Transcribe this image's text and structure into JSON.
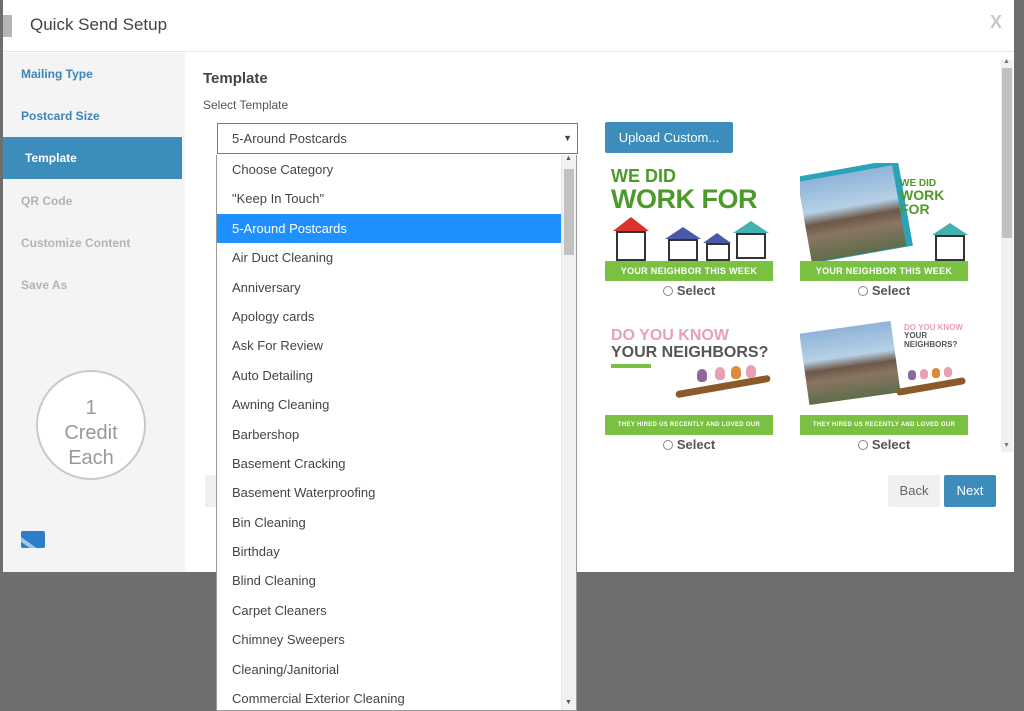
{
  "header": {
    "title": "Quick Send Setup",
    "close_label": "X"
  },
  "sidebar": {
    "items": [
      {
        "label": "Mailing Type",
        "state": "done"
      },
      {
        "label": "Postcard Size",
        "state": "done"
      },
      {
        "label": "Template",
        "state": "active"
      },
      {
        "label": "QR Code",
        "state": "todo"
      },
      {
        "label": "Customize Content",
        "state": "todo"
      },
      {
        "label": "Save As",
        "state": "todo"
      }
    ],
    "credit": {
      "number": "1",
      "line1": "Credit",
      "line2": "Each"
    }
  },
  "main": {
    "title": "Template",
    "subtitle": "Select Template",
    "select_value": "5-Around Postcards",
    "upload_label": "Upload Custom...",
    "templates": [
      {
        "line1": "WE DID",
        "line2": "WORK FOR",
        "band": "YOUR NEIGHBOR THIS WEEK",
        "select_label": "Select"
      },
      {
        "line1": "WE DID",
        "line2": "WORK FOR",
        "band": "YOUR NEIGHBOR THIS WEEK",
        "select_label": "Select"
      },
      {
        "line1": "DO YOU KNOW",
        "line2": "YOUR NEIGHBORS?",
        "band": "THEY HIRED US RECENTLY AND LOVED OUR SERVICE",
        "select_label": "Select"
      },
      {
        "line1": "DO YOU KNOW",
        "line2": "YOUR NEIGHBORS?",
        "band": "THEY HIRED US RECENTLY AND LOVED OUR SERVICE",
        "select_label": "Select"
      }
    ],
    "back_label": "Back",
    "next_label": "Next"
  },
  "dropdown": {
    "options": [
      "Choose Category",
      "\"Keep In Touch\"",
      "5-Around Postcards",
      "Air Duct Cleaning",
      "Anniversary",
      "Apology cards",
      "Ask For Review",
      "Auto Detailing",
      "Awning Cleaning",
      "Barbershop",
      "Basement Cracking",
      "Basement Waterproofing",
      "Bin Cleaning",
      "Birthday",
      "Blind Cleaning",
      "Carpet Cleaners",
      "Chimney Sweepers",
      "Cleaning/Janitorial",
      "Commercial Exterior Cleaning"
    ],
    "selected_index": 2
  },
  "colors": {
    "accent": "#3c8dbc",
    "selected": "#1e90ff",
    "green": "#7ac043",
    "headline_green": "#4c9a2a",
    "pink": "#e8a0b4"
  }
}
